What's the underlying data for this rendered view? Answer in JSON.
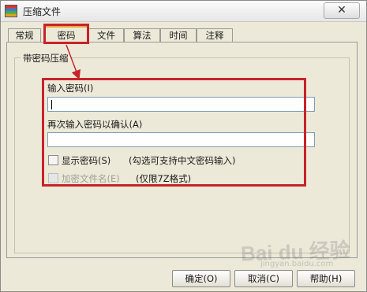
{
  "window": {
    "title": "压缩文件",
    "close_glyph": "✕"
  },
  "tabs": [
    {
      "label": "常规"
    },
    {
      "label": "密码"
    },
    {
      "label": "文件"
    },
    {
      "label": "算法"
    },
    {
      "label": "时间"
    },
    {
      "label": "注释"
    }
  ],
  "active_tab": "密码",
  "group": {
    "legend": "带密码压缩",
    "password_label": "输入密码(I)",
    "password_value": "",
    "confirm_label": "再次输入密码以确认(A)",
    "confirm_value": "",
    "show_password_label": "显示密码(S)",
    "show_password_hint": "(勾选可支持中文密码输入)",
    "show_password_checked": false,
    "encrypt_names_label": "加密文件名(E)",
    "encrypt_names_hint": "(仅限7Z格式)",
    "encrypt_names_checked": false,
    "encrypt_names_enabled": false
  },
  "buttons": {
    "ok": "确定(O)",
    "cancel": "取消(C)",
    "help": "帮助(H)"
  },
  "watermark": {
    "logo_text": "Bai du 经验",
    "url": "jingyan.baidu.com"
  },
  "colors": {
    "highlight_red": "#c8232a",
    "active_tab_accent": "#e8a33a",
    "dialog_bg": "#ece9d8"
  }
}
